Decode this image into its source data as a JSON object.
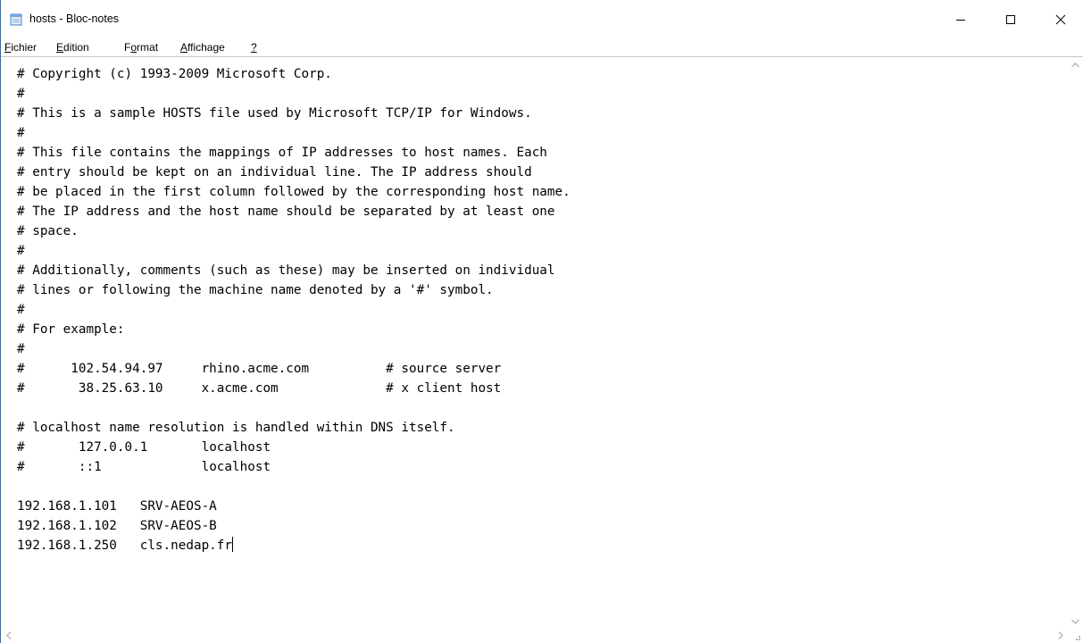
{
  "window": {
    "title": "hosts - Bloc-notes"
  },
  "menu": [
    {
      "label_pre": "",
      "accel": "F",
      "label_post": "ichier"
    },
    {
      "label_pre": "",
      "accel": "E",
      "label_post": "dition"
    },
    {
      "label_pre": "F",
      "accel": "o",
      "label_post": "rmat"
    },
    {
      "label_pre": "",
      "accel": "A",
      "label_post": "ffichage"
    },
    {
      "label_pre": "",
      "accel": "?",
      "label_post": ""
    }
  ],
  "editor": {
    "content": "# Copyright (c) 1993-2009 Microsoft Corp.\n#\n# This is a sample HOSTS file used by Microsoft TCP/IP for Windows.\n#\n# This file contains the mappings of IP addresses to host names. Each\n# entry should be kept on an individual line. The IP address should\n# be placed in the first column followed by the corresponding host name.\n# The IP address and the host name should be separated by at least one\n# space.\n#\n# Additionally, comments (such as these) may be inserted on individual\n# lines or following the machine name denoted by a '#' symbol.\n#\n# For example:\n#\n#      102.54.94.97     rhino.acme.com          # source server\n#       38.25.63.10     x.acme.com              # x client host\n\n# localhost name resolution is handled within DNS itself.\n#\t127.0.0.1       localhost\n#\t::1             localhost\n\n192.168.1.101   SRV-AEOS-A\n192.168.1.102   SRV-AEOS-B\n192.168.1.250   cls.nedap.fr"
  },
  "colors": {
    "window_border": "#1e6fc9",
    "scroll_arrow": "#a0a0a0"
  }
}
